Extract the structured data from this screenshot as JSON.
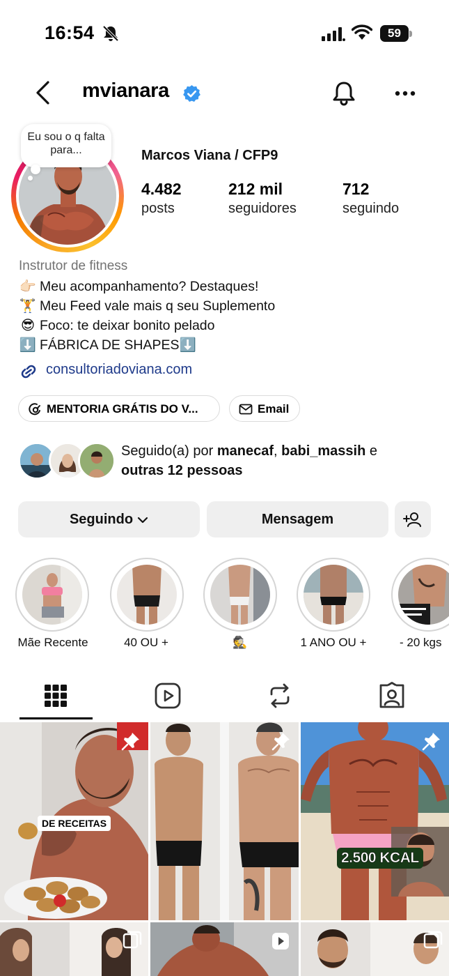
{
  "status_bar": {
    "time": "16:54",
    "battery": "59"
  },
  "header": {
    "username": "mvianara"
  },
  "profile": {
    "note": "Eu sou o q falta para...",
    "display_name": "Marcos Viana / CFP9",
    "stats": [
      {
        "value": "4.482",
        "label": "posts"
      },
      {
        "value": "212 mil",
        "label": "seguidores"
      },
      {
        "value": "712",
        "label": "seguindo"
      }
    ],
    "category": "Instrutor de fitness",
    "bio": [
      {
        "emoji": "👉🏻",
        "text": "Meu acompanhamento? Destaques!"
      },
      {
        "emoji": "🏋",
        "text": "Meu Feed vale mais q seu Suplemento"
      },
      {
        "emoji": "😎",
        "text": "Foco: te deixar bonito pelado"
      },
      {
        "emoji": "⬇️",
        "text": "FÁBRICA DE SHAPES⬇️"
      }
    ],
    "link": "consultoriadoviana.com"
  },
  "chips": {
    "threads": "MENTORIA GRÁTIS DO V...",
    "email": "Email"
  },
  "followed_by": {
    "prefix": "Seguido(a) por ",
    "user1": "manecaf",
    "separator": ", ",
    "user2": "babi_massih",
    "conj": " e",
    "others": "outras 12 pessoas"
  },
  "actions": {
    "following": "Seguindo",
    "message": "Mensagem"
  },
  "highlights": [
    {
      "label": "Mãe Recente",
      "color": "#c9a088"
    },
    {
      "label": "40 OU +",
      "color": "#b98567"
    },
    {
      "label": "🕵",
      "color": "#c99a80"
    },
    {
      "label": "1 ANO OU +",
      "color": "#b08068"
    },
    {
      "label": "- 20 kgs",
      "color": "#c48f72"
    }
  ],
  "grid": {
    "post1_tag": "DE RECEITAS",
    "post3_tag": "2.500 KCAL"
  }
}
